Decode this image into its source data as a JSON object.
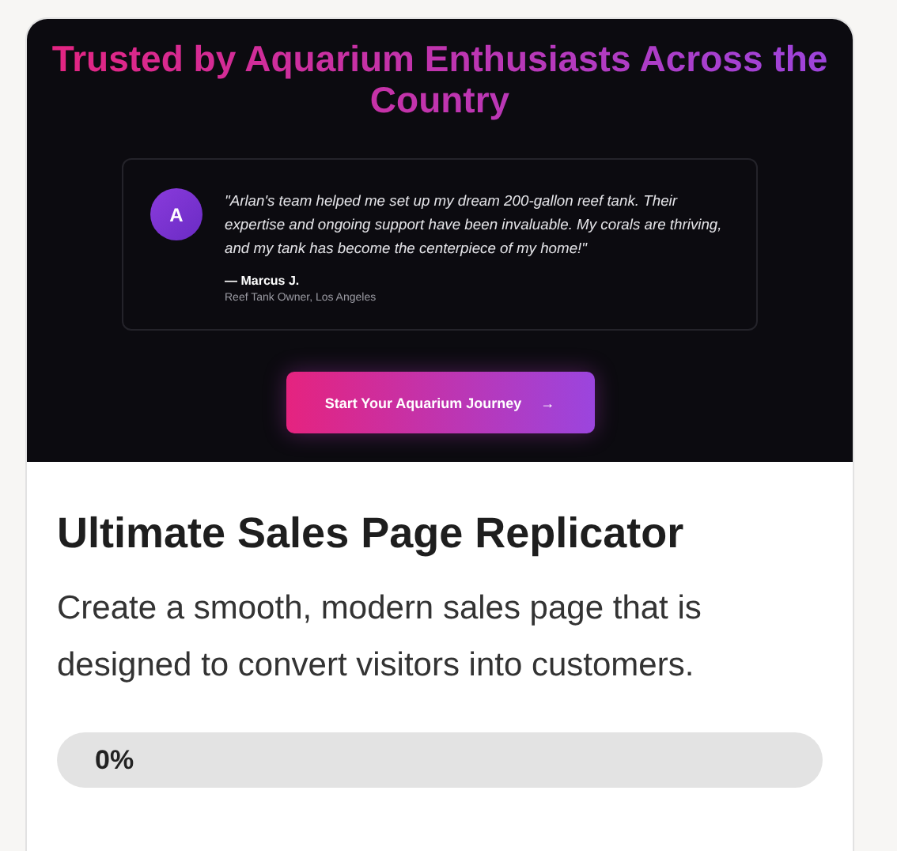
{
  "preview": {
    "heading": "Trusted by Aquarium Enthusiasts Across the Country",
    "testimonial": {
      "avatar_letter": "A",
      "quote": "\"Arlan's team helped me set up my dream 200-gallon reef tank. Their expertise and ongoing support have been invaluable. My corals are thriving, and my tank has become the centerpiece of my home!\"",
      "author": "— Marcus J.",
      "role": "Reef Tank Owner, Los Angeles"
    },
    "cta": {
      "label": "Start Your Aquarium Journey",
      "arrow": "→"
    }
  },
  "card": {
    "title": "Ultimate Sales Page Replicator",
    "description": "Create a smooth, modern sales page that is designed to convert visitors into customers.",
    "progress": {
      "level": 0,
      "reading": "0%"
    }
  }
}
